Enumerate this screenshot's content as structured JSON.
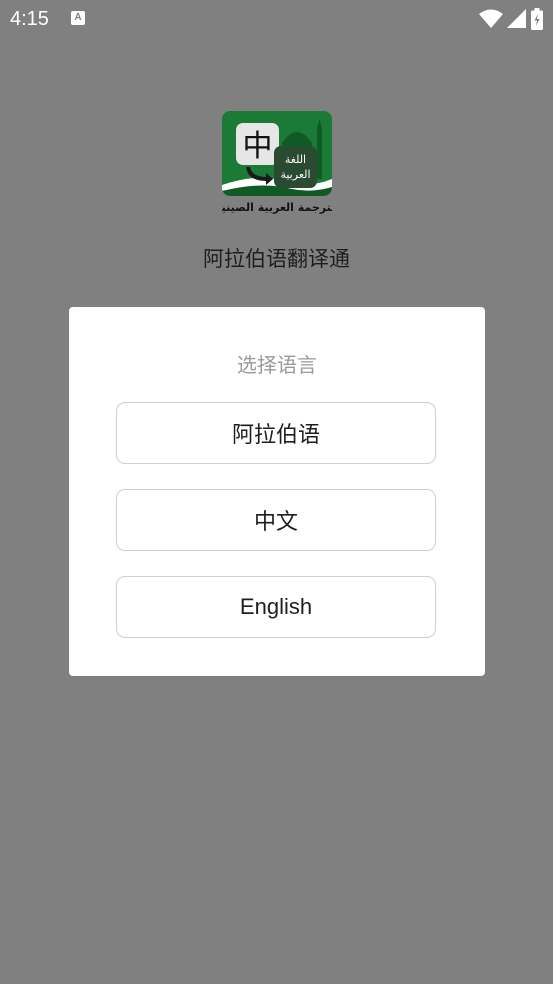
{
  "status_bar": {
    "time": "4:15",
    "notification_icon_letter": "A",
    "icons": [
      "wifi-icon",
      "signal-icon",
      "battery-icon"
    ]
  },
  "app": {
    "logo": {
      "chinese_char": "中",
      "arabic_label_line1": "اللغة",
      "arabic_label_line2": "العربية",
      "caption": "الترجمة العربية الصينية"
    },
    "title": "阿拉伯语翻译通"
  },
  "dialog": {
    "title": "选择语言",
    "options": [
      {
        "label": "阿拉伯语"
      },
      {
        "label": "中文"
      },
      {
        "label": "English"
      }
    ]
  },
  "colors": {
    "overlay": "#808080",
    "dialog_bg": "#ffffff",
    "logo_green": "#1a7a36",
    "button_border": "#cfcfcf"
  }
}
